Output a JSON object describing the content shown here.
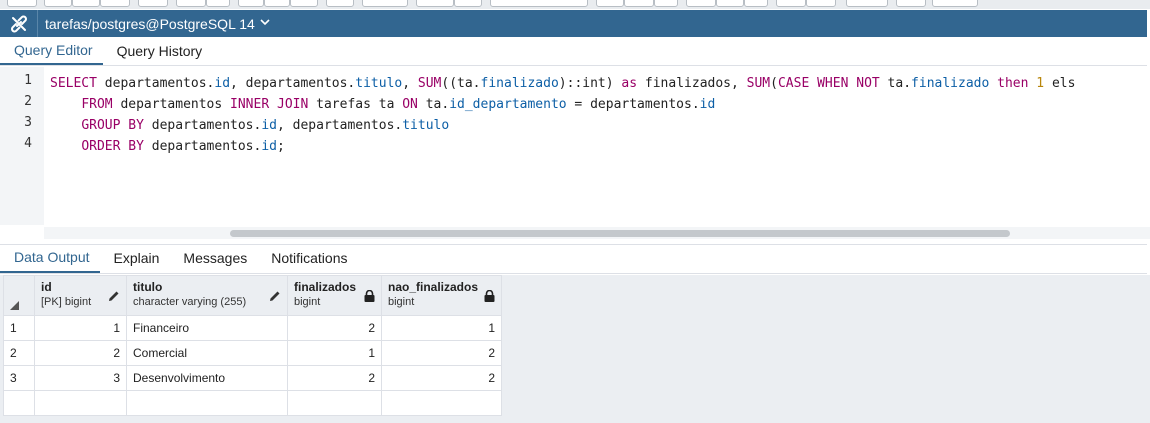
{
  "connection": {
    "title": "tarefas/postgres@PostgreSQL 14"
  },
  "editor_tabs": [
    {
      "label": "Query Editor",
      "active": true
    },
    {
      "label": "Query History",
      "active": false
    }
  ],
  "editor": {
    "line_numbers": [
      "1",
      "2",
      "3",
      "4"
    ],
    "lines": [
      "SELECT departamentos.id, departamentos.titulo, SUM((ta.finalizado)::int) as finalizados, SUM(CASE WHEN NOT ta.finalizado then 1 els",
      "    FROM departamentos INNER JOIN tarefas ta ON ta.id_departamento = departamentos.id",
      "    GROUP BY departamentos.id, departamentos.titulo",
      "    ORDER BY departamentos.id;"
    ]
  },
  "result_tabs": [
    {
      "label": "Data Output",
      "active": true
    },
    {
      "label": "Explain",
      "active": false
    },
    {
      "label": "Messages",
      "active": false
    },
    {
      "label": "Notifications",
      "active": false
    }
  ],
  "grid": {
    "columns": [
      {
        "name": "id",
        "type": "[PK] bigint",
        "icon": "pencil-icon"
      },
      {
        "name": "titulo",
        "type": "character varying (255)",
        "icon": "pencil-icon"
      },
      {
        "name": "finalizados",
        "type": "bigint",
        "icon": "lock-icon"
      },
      {
        "name": "nao_finalizados",
        "type": "bigint",
        "icon": "lock-icon"
      }
    ],
    "rows": [
      {
        "num": "1",
        "id": "1",
        "titulo": "Financeiro",
        "finalizados": "2",
        "nao_finalizados": "1"
      },
      {
        "num": "2",
        "id": "2",
        "titulo": "Comercial",
        "finalizados": "1",
        "nao_finalizados": "2"
      },
      {
        "num": "3",
        "id": "3",
        "titulo": "Desenvolvimento",
        "finalizados": "2",
        "nao_finalizados": "2"
      }
    ]
  },
  "colors": {
    "accent": "#326690",
    "keyword": "#990066",
    "field": "#0d5fa6",
    "number": "#b8860b"
  }
}
